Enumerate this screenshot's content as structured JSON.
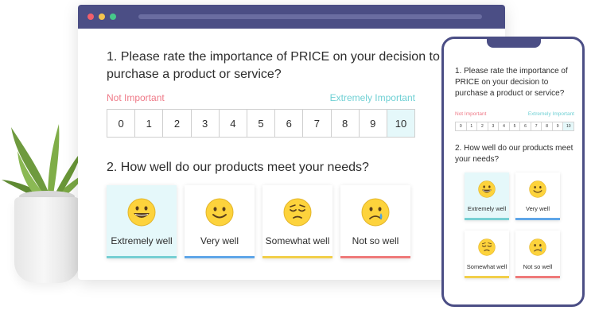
{
  "question1": {
    "text": "1. Please rate the importance of PRICE on your decision to purchase a product or service?",
    "low_label": "Not Important",
    "high_label": "Extremely Important",
    "scale": [
      "0",
      "1",
      "2",
      "3",
      "4",
      "5",
      "6",
      "7",
      "8",
      "9",
      "10"
    ],
    "selected": "10"
  },
  "question2": {
    "text": "2. How well do our products meet your needs?",
    "options": [
      {
        "label": "Extremely well",
        "icon": "grinning-face-icon",
        "color": "#76cfd3",
        "selected": true
      },
      {
        "label": "Very well",
        "icon": "smiling-face-icon",
        "color": "#5fa6e8",
        "selected": false
      },
      {
        "label": "Somewhat well",
        "icon": "pensive-face-icon",
        "color": "#f2cf4a",
        "selected": false
      },
      {
        "label": "Not so well",
        "icon": "crying-face-icon",
        "color": "#ef7a7a",
        "selected": false
      }
    ]
  },
  "colors": {
    "window_frame": "#4b4e85",
    "low_label": "#ef7a88",
    "high_label": "#6fd0d4",
    "selected_bg": "#e5f8fa",
    "emoji": "#fdd33c"
  }
}
